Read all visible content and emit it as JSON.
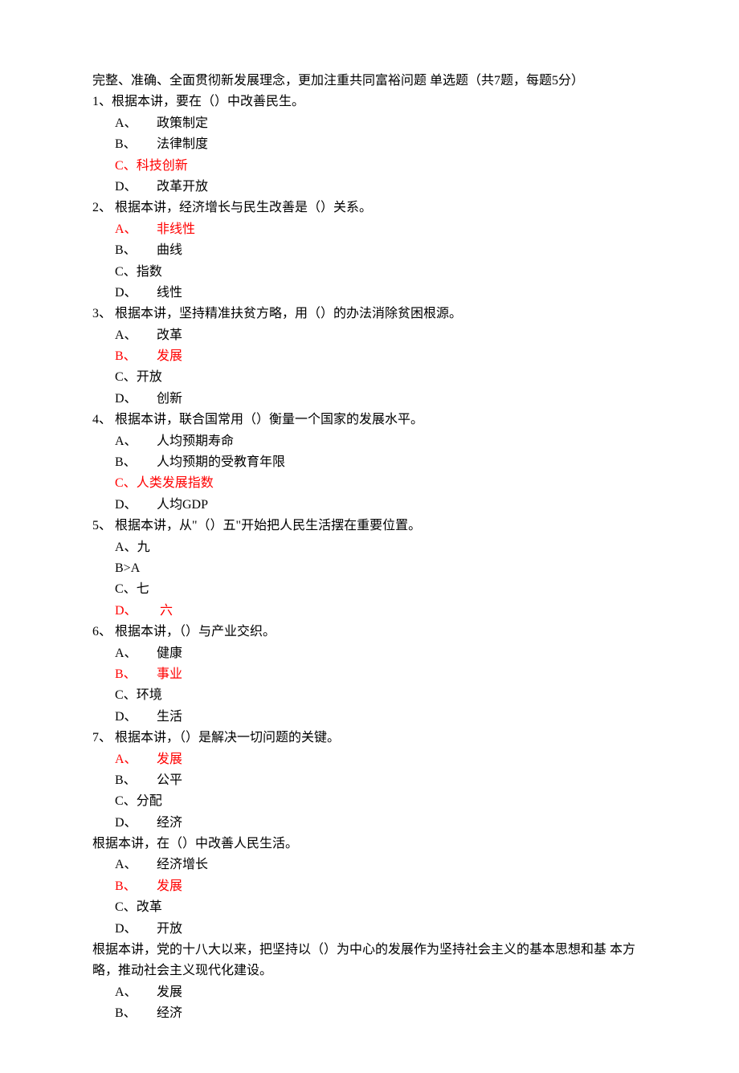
{
  "title": "完整、准确、全面贯彻新发展理念，更加注重共同富裕问题 单选题（共7题，每题5分）",
  "questions": [
    {
      "num": "1、",
      "text": "根据本讲，要在（）中改善民生。",
      "options": [
        {
          "marker": "A、",
          "text": "政策制定",
          "red": false,
          "wide": false
        },
        {
          "marker": "B、",
          "text": "法律制度",
          "red": false,
          "wide": false
        },
        {
          "marker": "C、",
          "text": "科技创新",
          "red": true,
          "wide": true
        },
        {
          "marker": "D、",
          "text": "改革开放",
          "red": false,
          "wide": false
        }
      ]
    },
    {
      "num": "2、",
      "text": " 根据本讲，经济增长与民生改善是（）关系。",
      "options": [
        {
          "marker": "A、",
          "text": "非线性",
          "red": true,
          "wide": false
        },
        {
          "marker": "B、",
          "text": "曲线",
          "red": false,
          "wide": false
        },
        {
          "marker": "C、",
          "text": "指数",
          "red": false,
          "wide": true
        },
        {
          "marker": "D、",
          "text": "线性",
          "red": false,
          "wide": false
        }
      ]
    },
    {
      "num": "3、",
      "text": " 根据本讲，坚持精准扶贫方略，用（）的办法消除贫困根源。",
      "options": [
        {
          "marker": "A、",
          "text": "改革",
          "red": false,
          "wide": false
        },
        {
          "marker": "B、",
          "text": "发展",
          "red": true,
          "wide": false
        },
        {
          "marker": "C、",
          "text": "开放",
          "red": false,
          "wide": true
        },
        {
          "marker": "D、",
          "text": "创新",
          "red": false,
          "wide": false
        }
      ]
    },
    {
      "num": "4、",
      "text": " 根据本讲，联合国常用（）衡量一个国家的发展水平。",
      "options": [
        {
          "marker": "A、",
          "text": "人均预期寿命",
          "red": false,
          "wide": false
        },
        {
          "marker": "B、",
          "text": "人均预期的受教育年限",
          "red": false,
          "wide": false
        },
        {
          "marker": "C、",
          "text": "人类发展指数",
          "red": true,
          "wide": true
        },
        {
          "marker": "D、",
          "text": "人均GDP",
          "red": false,
          "wide": false
        }
      ]
    },
    {
      "num": "5、",
      "text": " 根据本讲，从\"（）五\"开始把人民生活摆在重要位置。",
      "options": [
        {
          "marker": "A、",
          "text": "九",
          "red": false,
          "wide": true
        },
        {
          "marker": "B>A",
          "text": "",
          "red": false,
          "wide": true
        },
        {
          "marker": "C、",
          "text": "七",
          "red": false,
          "wide": true
        },
        {
          "marker": "D、",
          "text": "  六",
          "red": true,
          "wide": false
        }
      ]
    },
    {
      "num": "6、",
      "text": " 根据本讲，（）与产业交织。",
      "options": [
        {
          "marker": "A、",
          "text": "健康",
          "red": false,
          "wide": false
        },
        {
          "marker": "B、",
          "text": "事业",
          "red": true,
          "wide": false
        },
        {
          "marker": "C、",
          "text": "环境",
          "red": false,
          "wide": true
        },
        {
          "marker": "D、",
          "text": "生活",
          "red": false,
          "wide": false
        }
      ]
    },
    {
      "num": "7、",
      "text": " 根据本讲，（）是解决一切问题的关键。",
      "options": [
        {
          "marker": "A、",
          "text": "发展",
          "red": true,
          "wide": false
        },
        {
          "marker": "B、",
          "text": "公平",
          "red": false,
          "wide": false
        },
        {
          "marker": "C、",
          "text": "分配",
          "red": false,
          "wide": true
        },
        {
          "marker": "D、",
          "text": "经济",
          "red": false,
          "wide": false
        }
      ]
    }
  ],
  "extra": [
    {
      "text": "根据本讲，在（）中改善人民生活。",
      "options": [
        {
          "marker": "A、",
          "text": "经济增长",
          "red": false,
          "wide": false
        },
        {
          "marker": "B、",
          "text": "发展",
          "red": true,
          "wide": false
        },
        {
          "marker": "C、",
          "text": "改革",
          "red": false,
          "wide": true
        },
        {
          "marker": "D、",
          "text": "开放",
          "red": false,
          "wide": false
        }
      ]
    },
    {
      "text": "根据本讲，党的十八大以来，把坚持以（）为中心的发展作为坚持社会主义的基本思想和基 本方略，推动社会主义现代化建设。",
      "options": [
        {
          "marker": "A、",
          "text": "发展",
          "red": false,
          "wide": false
        },
        {
          "marker": "B、",
          "text": "经济",
          "red": false,
          "wide": false
        }
      ]
    }
  ]
}
